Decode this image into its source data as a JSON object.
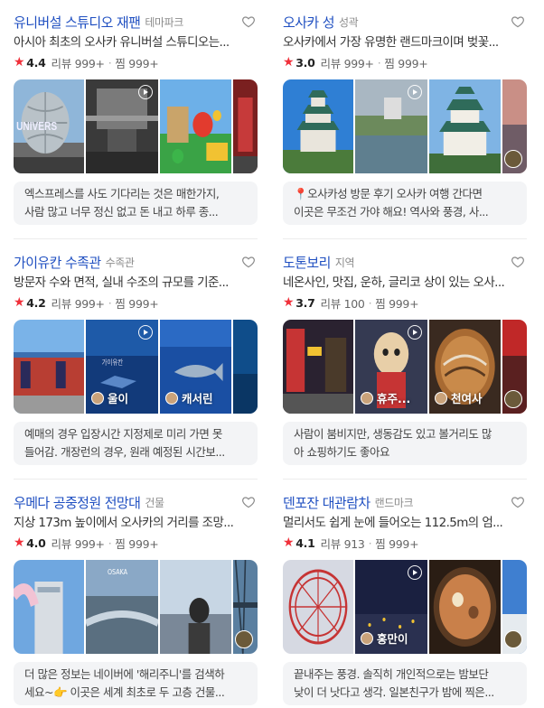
{
  "places": [
    {
      "name": "유니버설 스튜디오 재팬",
      "category": "테마파크",
      "description": "아시아 최초의 오사카 유니버설 스튜디오는...",
      "rating": "4.4",
      "reviews": "리뷰 999+",
      "saves": "찜 999+",
      "photos": [
        {
          "theme": "universal-globe"
        },
        {
          "theme": "show-stage",
          "video": true
        },
        {
          "theme": "mario-world"
        },
        {
          "theme": "red-structure"
        }
      ],
      "review_lines": [
        "엑스프레스를 사도 기다리는 것은 매한가지,",
        "사람 많고 너무 정신 없고 돈 내고 하루 종..."
      ]
    },
    {
      "name": "오사카 성",
      "category": "성곽",
      "description": "오사카에서 가장 유명한 랜드마크이며 벚꽃...",
      "rating": "3.0",
      "reviews": "리뷰 999+",
      "saves": "찜 999+",
      "photos": [
        {
          "theme": "castle-blue"
        },
        {
          "theme": "castle-moat",
          "video": true
        },
        {
          "theme": "castle-sky"
        },
        {
          "theme": "dusk-sky",
          "corner_avatar": true
        }
      ],
      "review_lines": [
        "📍오사카성 방문 후기 오사카 여행 간다면",
        "이곳은 무조건 가야 해요! 역사와 풍경, 사..."
      ]
    },
    {
      "name": "가이유칸 수족관",
      "category": "수족관",
      "description": "방문자 수와 면적, 실내 수조의 규모를 기준...",
      "rating": "4.2",
      "reviews": "리뷰 999+",
      "saves": "찜 999+",
      "photos": [
        {
          "theme": "aquarium-building"
        },
        {
          "theme": "aquarium-tank",
          "video": true,
          "author": "울이"
        },
        {
          "theme": "whale-shark",
          "author": "캐서린"
        },
        {
          "theme": "deep-blue"
        }
      ],
      "review_lines": [
        "예매의 경우 입장시간 지정제로 미리 가면 못",
        "들어감. 개장런의 경우, 원래 예정된 시간보..."
      ]
    },
    {
      "name": "도톤보리",
      "category": "지역",
      "description": "네온사인, 맛집, 운하, 글리코 상이 있는 오사...",
      "rating": "3.7",
      "reviews": "리뷰 100",
      "saves": "찜 999+",
      "photos": [
        {
          "theme": "street-night"
        },
        {
          "theme": "kuidaore",
          "video": true,
          "author": "휴주..."
        },
        {
          "theme": "okonomiyaki",
          "author": "천여사"
        },
        {
          "theme": "neon-red",
          "corner_avatar": true
        }
      ],
      "review_lines": [
        "사람이 붐비지만, 생동감도 있고 볼거리도 많",
        "아 쇼핑하기도 좋아요"
      ]
    },
    {
      "name": "우메다 공중정원 전망대",
      "category": "건물",
      "description": "지상 173m 높이에서 오사카의 거리를 조망...",
      "rating": "4.0",
      "reviews": "리뷰 999+",
      "saves": "찜 999+",
      "photos": [
        {
          "theme": "sky-building"
        },
        {
          "theme": "city-view"
        },
        {
          "theme": "girl-view"
        },
        {
          "theme": "tower-steel",
          "corner_avatar": true
        }
      ],
      "review_lines": [
        "더 많은 정보는 네이버에 '해리주니'를 검색하",
        "세요~👉 이곳은 세계 최초로 두 고층 건물..."
      ]
    },
    {
      "name": "덴포잔 대관람차",
      "category": "랜드마크",
      "description": "멀리서도 쉽게 눈에 들어오는 112.5m의 엄...",
      "rating": "4.1",
      "reviews": "리뷰 913",
      "saves": "찜 999+",
      "photos": [
        {
          "theme": "ferris-wheel"
        },
        {
          "theme": "night-city",
          "video": true,
          "author": "홍만이"
        },
        {
          "theme": "ramen"
        },
        {
          "theme": "blue-sky-city",
          "corner_avatar": true
        }
      ],
      "review_lines": [
        "끝내주는 풍경. 솔직히 개인적으로는 밤보단",
        "낮이 더 낫다고 생각. 일본친구가 밤에 찍은..."
      ]
    }
  ],
  "colors": {
    "name": "#1f4fc1",
    "star": "#f0303a",
    "review_bg": "#f3f4f6"
  },
  "icons": {
    "favorite": "heart-outline-icon",
    "video": "play-circle-icon",
    "rating": "star-icon"
  }
}
